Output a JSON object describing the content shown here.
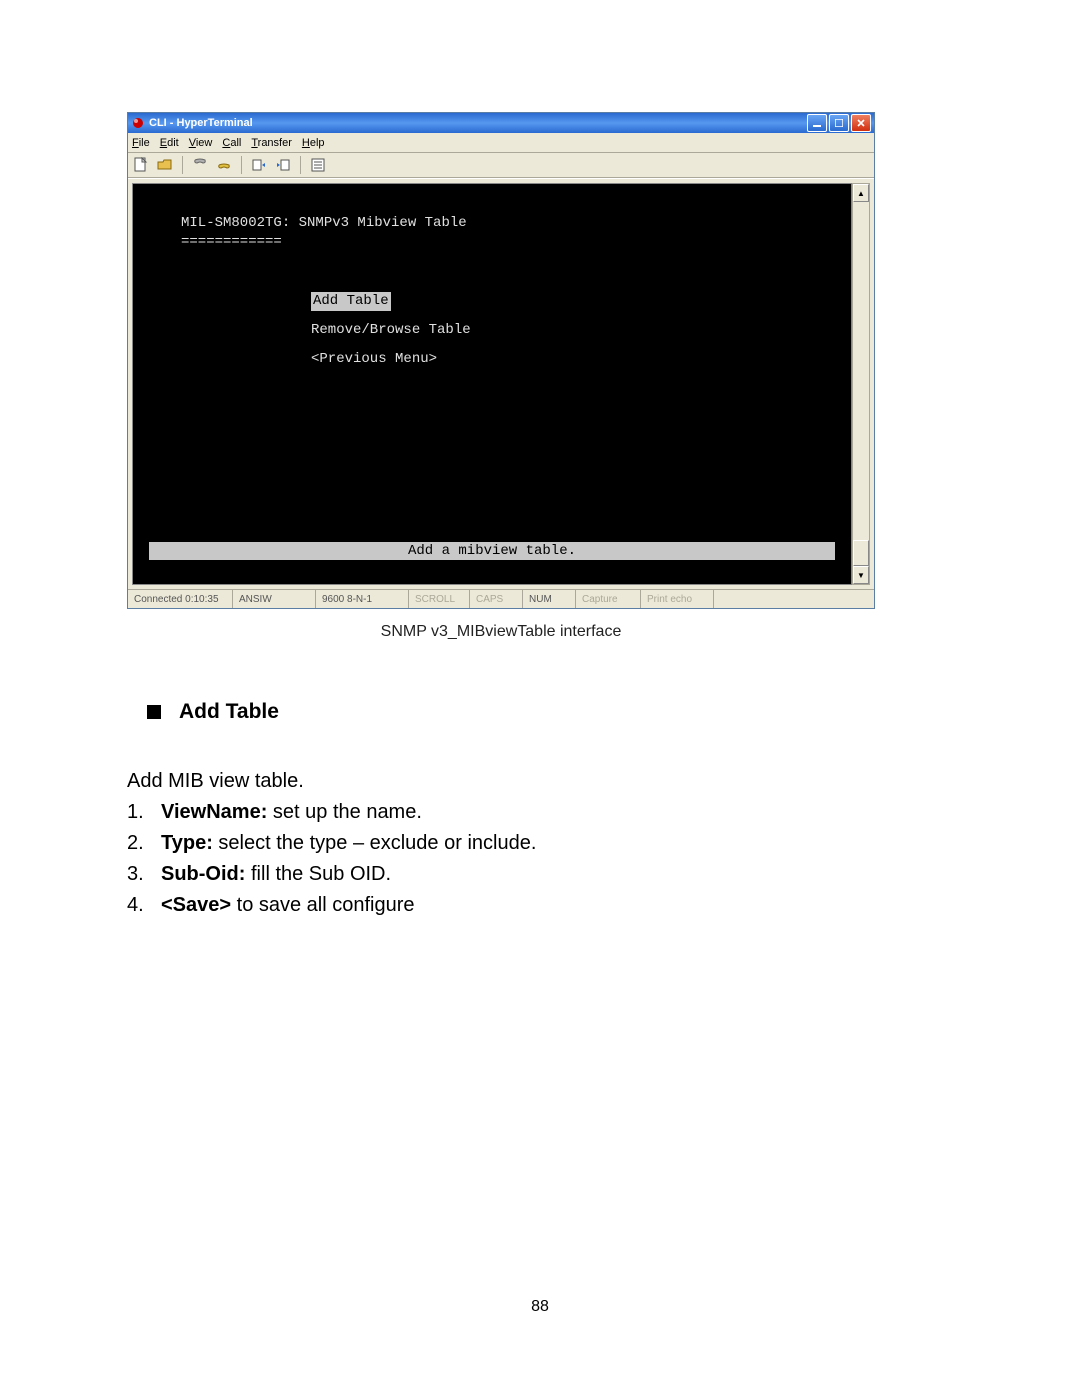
{
  "window": {
    "title": "CLI - HyperTerminal",
    "menus": {
      "file": "File",
      "edit": "Edit",
      "view": "View",
      "call": "Call",
      "transfer": "Transfer",
      "help": "Help"
    },
    "status": {
      "connected": "Connected 0:10:35",
      "emulation": "ANSIW",
      "settings": "9600 8-N-1",
      "scroll": "SCROLL",
      "caps": "CAPS",
      "num": "NUM",
      "capture": "Capture",
      "echo": "Print echo"
    }
  },
  "terminal": {
    "heading": "MIL-SM8002TG: SNMPv3 Mibview Table",
    "rule": "============",
    "items": {
      "add": "Add Table",
      "remove": "Remove/Browse Table",
      "prev": "<Previous Menu>"
    },
    "footer": "Add a mibview table."
  },
  "caption": "SNMP v3_MIBviewTable interface",
  "doc": {
    "heading": "Add Table",
    "intro": "Add MIB view table.",
    "list": [
      {
        "num": "1.",
        "bold": "ViewName:",
        "rest": " set up the name."
      },
      {
        "num": "2.",
        "bold": "Type:",
        "rest": " select the type – exclude or include."
      },
      {
        "num": "3.",
        "bold": "Sub-Oid:",
        "rest": " fill the Sub OID."
      },
      {
        "num": "4.",
        "bold": "<Save>",
        "rest": " to save all configure"
      }
    ]
  },
  "pagenum": "88"
}
